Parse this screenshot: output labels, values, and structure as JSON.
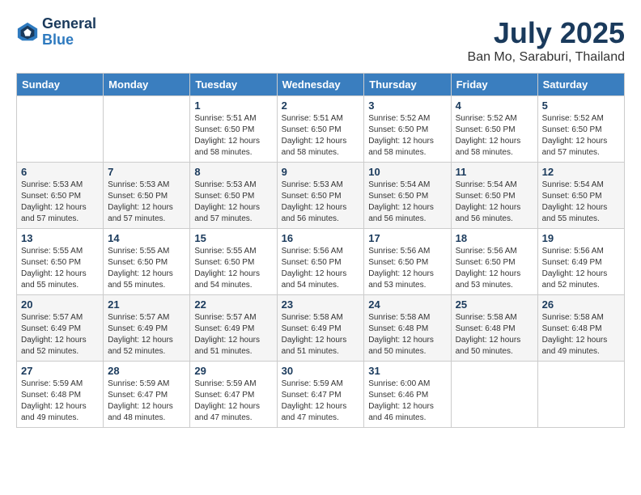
{
  "logo": {
    "text_general": "General",
    "text_blue": "Blue"
  },
  "title": "July 2025",
  "subtitle": "Ban Mo, Saraburi, Thailand",
  "days_of_week": [
    "Sunday",
    "Monday",
    "Tuesday",
    "Wednesday",
    "Thursday",
    "Friday",
    "Saturday"
  ],
  "weeks": [
    [
      {
        "day": "",
        "sunrise": "",
        "sunset": "",
        "daylight": ""
      },
      {
        "day": "",
        "sunrise": "",
        "sunset": "",
        "daylight": ""
      },
      {
        "day": "1",
        "sunrise": "Sunrise: 5:51 AM",
        "sunset": "Sunset: 6:50 PM",
        "daylight": "Daylight: 12 hours and 58 minutes."
      },
      {
        "day": "2",
        "sunrise": "Sunrise: 5:51 AM",
        "sunset": "Sunset: 6:50 PM",
        "daylight": "Daylight: 12 hours and 58 minutes."
      },
      {
        "day": "3",
        "sunrise": "Sunrise: 5:52 AM",
        "sunset": "Sunset: 6:50 PM",
        "daylight": "Daylight: 12 hours and 58 minutes."
      },
      {
        "day": "4",
        "sunrise": "Sunrise: 5:52 AM",
        "sunset": "Sunset: 6:50 PM",
        "daylight": "Daylight: 12 hours and 58 minutes."
      },
      {
        "day": "5",
        "sunrise": "Sunrise: 5:52 AM",
        "sunset": "Sunset: 6:50 PM",
        "daylight": "Daylight: 12 hours and 57 minutes."
      }
    ],
    [
      {
        "day": "6",
        "sunrise": "Sunrise: 5:53 AM",
        "sunset": "Sunset: 6:50 PM",
        "daylight": "Daylight: 12 hours and 57 minutes."
      },
      {
        "day": "7",
        "sunrise": "Sunrise: 5:53 AM",
        "sunset": "Sunset: 6:50 PM",
        "daylight": "Daylight: 12 hours and 57 minutes."
      },
      {
        "day": "8",
        "sunrise": "Sunrise: 5:53 AM",
        "sunset": "Sunset: 6:50 PM",
        "daylight": "Daylight: 12 hours and 57 minutes."
      },
      {
        "day": "9",
        "sunrise": "Sunrise: 5:53 AM",
        "sunset": "Sunset: 6:50 PM",
        "daylight": "Daylight: 12 hours and 56 minutes."
      },
      {
        "day": "10",
        "sunrise": "Sunrise: 5:54 AM",
        "sunset": "Sunset: 6:50 PM",
        "daylight": "Daylight: 12 hours and 56 minutes."
      },
      {
        "day": "11",
        "sunrise": "Sunrise: 5:54 AM",
        "sunset": "Sunset: 6:50 PM",
        "daylight": "Daylight: 12 hours and 56 minutes."
      },
      {
        "day": "12",
        "sunrise": "Sunrise: 5:54 AM",
        "sunset": "Sunset: 6:50 PM",
        "daylight": "Daylight: 12 hours and 55 minutes."
      }
    ],
    [
      {
        "day": "13",
        "sunrise": "Sunrise: 5:55 AM",
        "sunset": "Sunset: 6:50 PM",
        "daylight": "Daylight: 12 hours and 55 minutes."
      },
      {
        "day": "14",
        "sunrise": "Sunrise: 5:55 AM",
        "sunset": "Sunset: 6:50 PM",
        "daylight": "Daylight: 12 hours and 55 minutes."
      },
      {
        "day": "15",
        "sunrise": "Sunrise: 5:55 AM",
        "sunset": "Sunset: 6:50 PM",
        "daylight": "Daylight: 12 hours and 54 minutes."
      },
      {
        "day": "16",
        "sunrise": "Sunrise: 5:56 AM",
        "sunset": "Sunset: 6:50 PM",
        "daylight": "Daylight: 12 hours and 54 minutes."
      },
      {
        "day": "17",
        "sunrise": "Sunrise: 5:56 AM",
        "sunset": "Sunset: 6:50 PM",
        "daylight": "Daylight: 12 hours and 53 minutes."
      },
      {
        "day": "18",
        "sunrise": "Sunrise: 5:56 AM",
        "sunset": "Sunset: 6:50 PM",
        "daylight": "Daylight: 12 hours and 53 minutes."
      },
      {
        "day": "19",
        "sunrise": "Sunrise: 5:56 AM",
        "sunset": "Sunset: 6:49 PM",
        "daylight": "Daylight: 12 hours and 52 minutes."
      }
    ],
    [
      {
        "day": "20",
        "sunrise": "Sunrise: 5:57 AM",
        "sunset": "Sunset: 6:49 PM",
        "daylight": "Daylight: 12 hours and 52 minutes."
      },
      {
        "day": "21",
        "sunrise": "Sunrise: 5:57 AM",
        "sunset": "Sunset: 6:49 PM",
        "daylight": "Daylight: 12 hours and 52 minutes."
      },
      {
        "day": "22",
        "sunrise": "Sunrise: 5:57 AM",
        "sunset": "Sunset: 6:49 PM",
        "daylight": "Daylight: 12 hours and 51 minutes."
      },
      {
        "day": "23",
        "sunrise": "Sunrise: 5:58 AM",
        "sunset": "Sunset: 6:49 PM",
        "daylight": "Daylight: 12 hours and 51 minutes."
      },
      {
        "day": "24",
        "sunrise": "Sunrise: 5:58 AM",
        "sunset": "Sunset: 6:48 PM",
        "daylight": "Daylight: 12 hours and 50 minutes."
      },
      {
        "day": "25",
        "sunrise": "Sunrise: 5:58 AM",
        "sunset": "Sunset: 6:48 PM",
        "daylight": "Daylight: 12 hours and 50 minutes."
      },
      {
        "day": "26",
        "sunrise": "Sunrise: 5:58 AM",
        "sunset": "Sunset: 6:48 PM",
        "daylight": "Daylight: 12 hours and 49 minutes."
      }
    ],
    [
      {
        "day": "27",
        "sunrise": "Sunrise: 5:59 AM",
        "sunset": "Sunset: 6:48 PM",
        "daylight": "Daylight: 12 hours and 49 minutes."
      },
      {
        "day": "28",
        "sunrise": "Sunrise: 5:59 AM",
        "sunset": "Sunset: 6:47 PM",
        "daylight": "Daylight: 12 hours and 48 minutes."
      },
      {
        "day": "29",
        "sunrise": "Sunrise: 5:59 AM",
        "sunset": "Sunset: 6:47 PM",
        "daylight": "Daylight: 12 hours and 47 minutes."
      },
      {
        "day": "30",
        "sunrise": "Sunrise: 5:59 AM",
        "sunset": "Sunset: 6:47 PM",
        "daylight": "Daylight: 12 hours and 47 minutes."
      },
      {
        "day": "31",
        "sunrise": "Sunrise: 6:00 AM",
        "sunset": "Sunset: 6:46 PM",
        "daylight": "Daylight: 12 hours and 46 minutes."
      },
      {
        "day": "",
        "sunrise": "",
        "sunset": "",
        "daylight": ""
      },
      {
        "day": "",
        "sunrise": "",
        "sunset": "",
        "daylight": ""
      }
    ]
  ]
}
